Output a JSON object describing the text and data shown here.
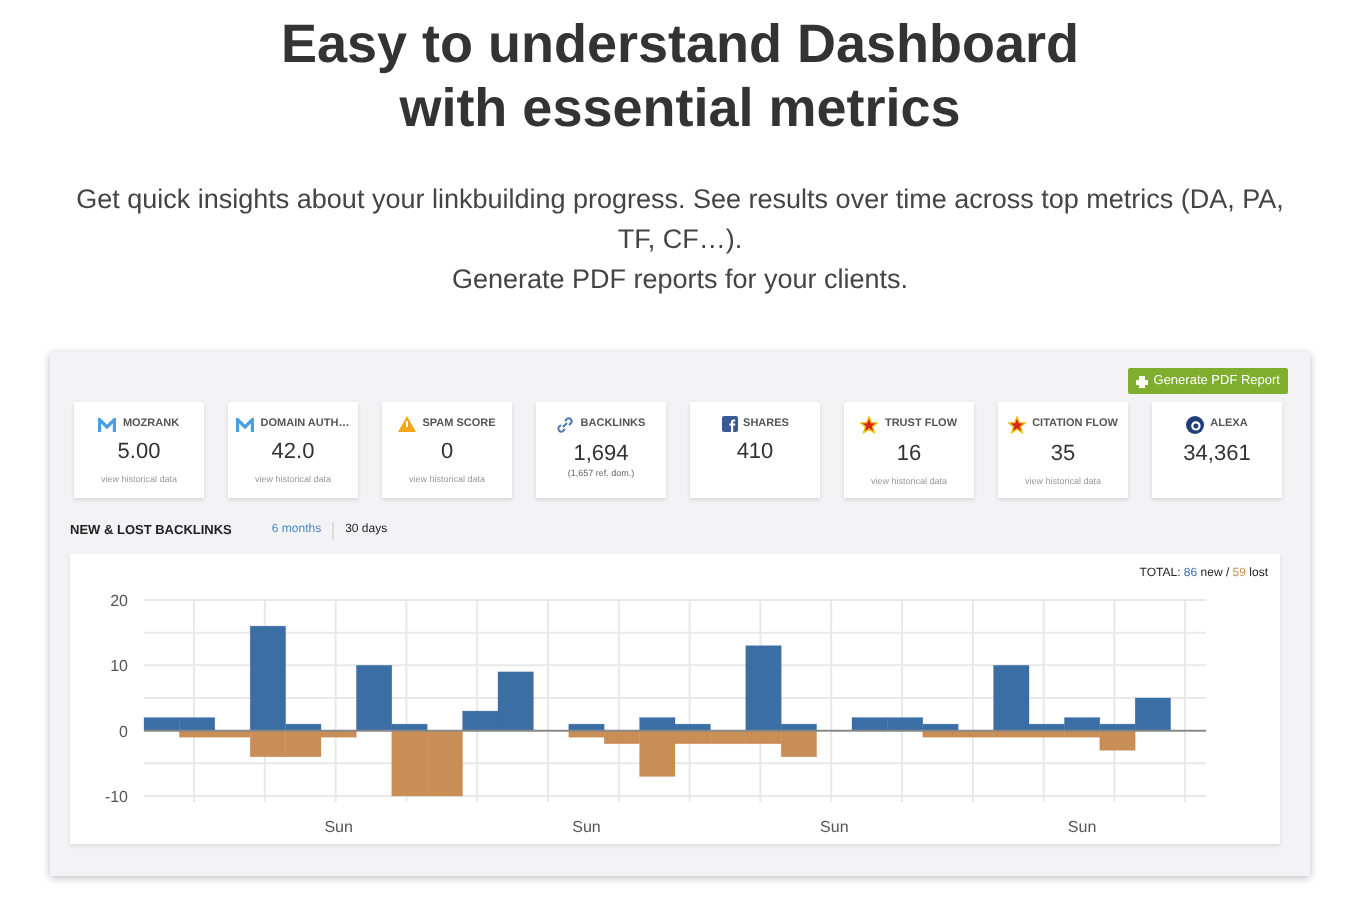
{
  "hero": {
    "title_lines": [
      "Easy to understand Dashboard",
      "with essential metrics"
    ],
    "description_lines": [
      "Get quick insights about your linkbuilding progress. See results over time across top metrics (DA, PA,",
      "TF, CF…).",
      "Generate PDF reports for your clients."
    ]
  },
  "dashboard": {
    "report_button": "Generate PDF Report",
    "metrics": [
      {
        "kind": "moz",
        "label": "MOZRANK",
        "value": "5.00",
        "link": "view historical data"
      },
      {
        "kind": "moz",
        "label": "DOMAIN AUTH…",
        "value": "42.0",
        "link": "view historical data"
      },
      {
        "kind": "warning",
        "label": "SPAM SCORE",
        "value": "0",
        "link": "view historical data"
      },
      {
        "kind": "link",
        "label": "BACKLINKS",
        "value": "1,694",
        "note": "(1,657 ref. dom.)"
      },
      {
        "kind": "facebook",
        "label": "SHARES",
        "value": "410"
      },
      {
        "kind": "star",
        "label": "TRUST FLOW",
        "value": "16",
        "link": "view historical data"
      },
      {
        "kind": "star",
        "label": "CITATION FLOW",
        "value": "35",
        "link": "view historical data"
      },
      {
        "kind": "alexa",
        "label": "ALEXA",
        "value": "34,361"
      }
    ],
    "backlinks": {
      "title": "NEW & LOST BACKLINKS",
      "ranges": [
        {
          "label": "6 months",
          "selected": false
        },
        {
          "label": "30 days",
          "selected": true
        }
      ],
      "total": {
        "prefix": "TOTAL:",
        "new_count": "86",
        "separator": "/",
        "lost_count": "59"
      },
      "chart_data": {
        "type": "bar",
        "stacked": true,
        "categories": [
          null,
          null,
          null,
          null,
          null,
          "Sun",
          null,
          null,
          null,
          null,
          null,
          null,
          "Sun",
          null,
          null,
          null,
          null,
          null,
          null,
          "Sun",
          null,
          null,
          null,
          null,
          null,
          null,
          "Sun",
          null,
          null,
          null
        ],
        "series": [
          {
            "name": "new",
            "color": "#3b6ea5",
            "values": [
              2,
              2,
              0,
              16,
              1,
              0,
              10,
              1,
              0,
              3,
              9,
              0,
              1,
              0,
              2,
              1,
              0,
              13,
              1,
              0,
              2,
              2,
              1,
              0,
              10,
              1,
              2,
              1,
              5,
              0
            ]
          },
          {
            "name": "lost",
            "color": "#c98e55",
            "values": [
              0,
              -1,
              -1,
              -4,
              -4,
              -1,
              0,
              -10,
              -10,
              0,
              0,
              0,
              -1,
              -2,
              -7,
              -2,
              -2,
              -2,
              -4,
              0,
              0,
              0,
              -1,
              -1,
              -1,
              -1,
              -1,
              -3,
              0,
              0
            ]
          }
        ],
        "grid": true,
        "ylim": [
          -10,
          20
        ],
        "yticks": [
          {
            "value": -10,
            "label": "-10"
          },
          {
            "value": 0,
            "label": "0"
          },
          {
            "value": 10,
            "label": "10"
          },
          {
            "value": 20,
            "label": "20"
          }
        ]
      }
    }
  }
}
